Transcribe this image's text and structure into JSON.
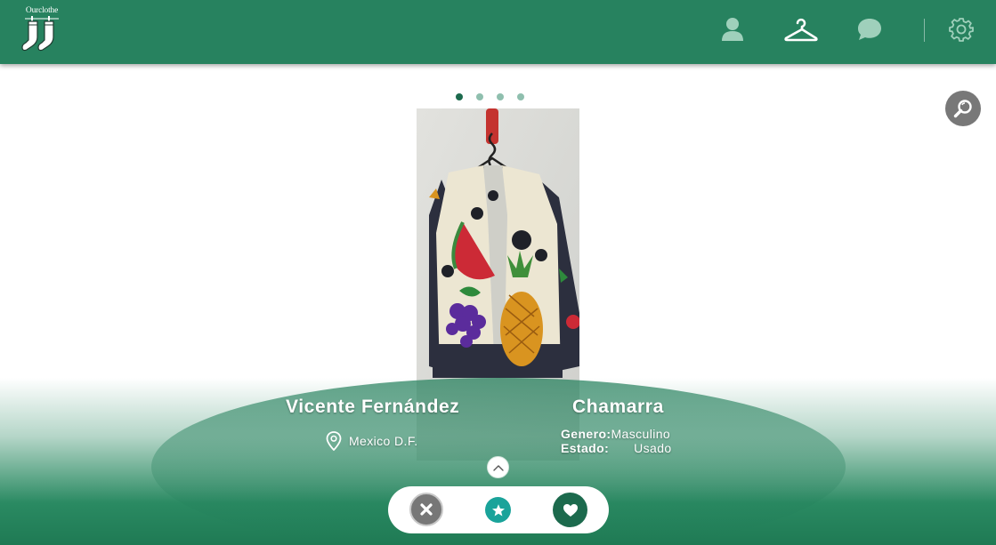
{
  "app": {
    "logo_text": "Ourclothe"
  },
  "nav": {
    "icons": [
      "user-icon",
      "hanger-icon",
      "chat-icon",
      "gear-icon"
    ],
    "active": "hanger-icon"
  },
  "carousel": {
    "total": 4,
    "active_index": 0
  },
  "listing": {
    "seller_name": "Vicente Fernández",
    "location": "Mexico D.F.",
    "item_name": "Chamarra",
    "genero_label": "Genero:",
    "genero_value": "Masculino",
    "estado_label": "Estado:",
    "estado_value": "Usado"
  },
  "colors": {
    "primary": "#27825f",
    "dark_green": "#1c6a4d",
    "teal": "#1aa39a",
    "gray": "#777777"
  }
}
